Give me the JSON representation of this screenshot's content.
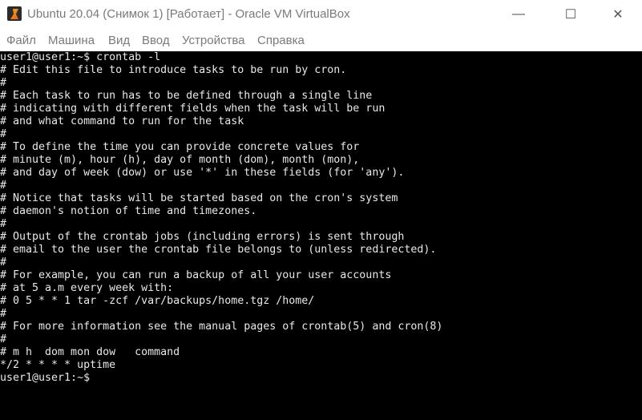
{
  "window": {
    "title": "Ubuntu 20.04 (Снимок 1) [Работает] - Oracle VM VirtualBox",
    "icon": "virtualbox-icon",
    "controls": {
      "minimize": "—",
      "maximize": "☐",
      "close": "✕"
    }
  },
  "menu": [
    "Файл",
    "Машина",
    "Вид",
    "Ввод",
    "Устройства",
    "Справка"
  ],
  "terminal": {
    "lines": [
      "user1@user1:~$ crontab -l",
      "# Edit this file to introduce tasks to be run by cron.",
      "#",
      "# Each task to run has to be defined through a single line",
      "# indicating with different fields when the task will be run",
      "# and what command to run for the task",
      "#",
      "# To define the time you can provide concrete values for",
      "# minute (m), hour (h), day of month (dom), month (mon),",
      "# and day of week (dow) or use '*' in these fields (for 'any').",
      "#",
      "# Notice that tasks will be started based on the cron's system",
      "# daemon's notion of time and timezones.",
      "#",
      "# Output of the crontab jobs (including errors) is sent through",
      "# email to the user the crontab file belongs to (unless redirected).",
      "#",
      "# For example, you can run a backup of all your user accounts",
      "# at 5 a.m every week with:",
      "# 0 5 * * 1 tar -zcf /var/backups/home.tgz /home/",
      "#",
      "# For more information see the manual pages of crontab(5) and cron(8)",
      "#",
      "# m h  dom mon dow   command",
      "*/2 * * * * uptime",
      "user1@user1:~$"
    ]
  }
}
